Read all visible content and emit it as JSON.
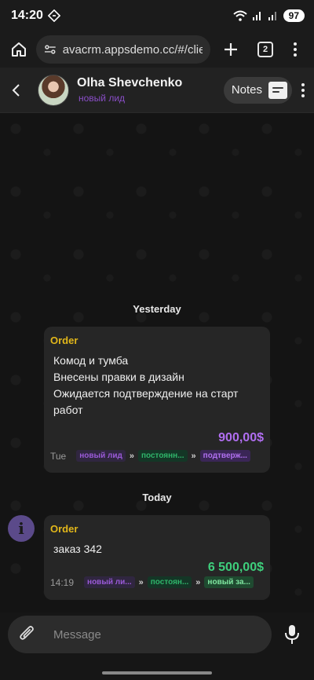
{
  "status_bar": {
    "time": "14:20",
    "battery": "97"
  },
  "browser": {
    "url": "avacrm.appsdemo.cc/#/clie",
    "tab_count": "2"
  },
  "chat_header": {
    "contact_name": "Olha Shevchenko",
    "contact_status": "новый лид",
    "notes_label": "Notes"
  },
  "messages": [
    {
      "day": "Yesterday",
      "title": "Order",
      "lines": [
        "Комод и тумба",
        "Внесены правки в дизайн",
        "Ожидается подтверждение на старт",
        "работ"
      ],
      "amount": "900,00$",
      "amount_color": "#b06ef0",
      "date": "Tue",
      "tags": [
        "новый лид",
        "постоянн...",
        "подтверж..."
      ]
    },
    {
      "day": "Today",
      "title": "Order",
      "lines": [
        "заказ 342"
      ],
      "amount": "6 500,00$",
      "amount_color": "#3ecf7c",
      "date": "14:19",
      "tags": [
        "новый ли...",
        "постоян...",
        "новый за..."
      ]
    }
  ],
  "composer": {
    "placeholder": "Message"
  },
  "colors": {
    "title": "#e2b71a",
    "status": "#8a4ec8"
  }
}
